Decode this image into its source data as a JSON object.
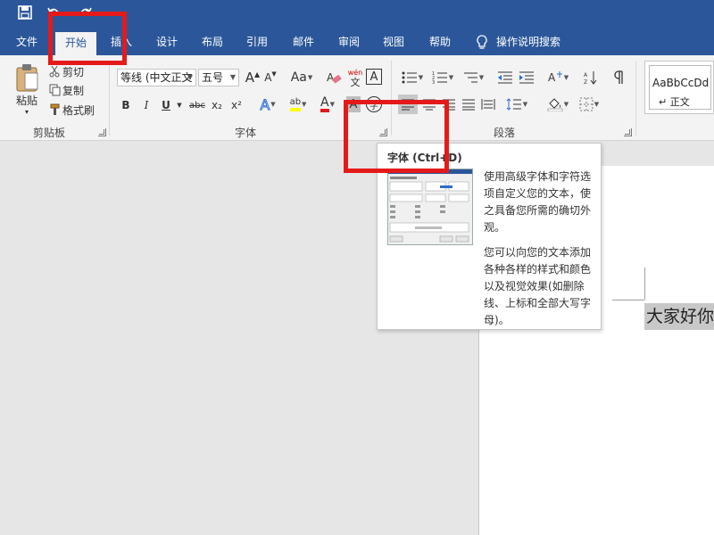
{
  "tabs": {
    "file": "文件",
    "home": "开始",
    "insert": "插入",
    "design": "设计",
    "layout": "布局",
    "references": "引用",
    "mailings": "邮件",
    "review": "审阅",
    "view": "视图",
    "help": "帮助",
    "tell_me": "操作说明搜索"
  },
  "clipboard": {
    "paste": "粘贴",
    "cut": "剪切",
    "copy": "复制",
    "format_painter": "格式刷",
    "group_label": "剪贴板"
  },
  "font": {
    "font_name": "等线 (中文正文",
    "font_size": "五号",
    "grow": "A",
    "shrink": "A",
    "change_case": "Aa",
    "clear_format": "A",
    "phonetic_top": "wén",
    "phonetic_bottom": "文",
    "char_border": "A",
    "bold": "B",
    "italic": "I",
    "underline": "U",
    "strike": "abc",
    "subscript": "x₂",
    "superscript": "x²",
    "text_effects": "A",
    "highlight": "ab",
    "font_color": "A",
    "char_shading": "A",
    "enclose": "字",
    "group_label": "字体"
  },
  "paragraph": {
    "group_label": "段落"
  },
  "styles": {
    "sample": "AaBbCcDd",
    "normal": "↵ 正文"
  },
  "tooltip": {
    "title": "字体 (Ctrl+D)",
    "para1": "使用高级字体和字符选项自定义您的文本，使之具备您所需的确切外观。",
    "para2": "您可以向您的文本添加各种各样的样式和颜色以及视觉效果(如删除线、上标和全部大写字母)。"
  },
  "document": {
    "text": "大家好你好"
  },
  "colors": {
    "brand": "#2b579a",
    "highlight": "#e41a1a",
    "ribbon": "#f3f3f3"
  }
}
